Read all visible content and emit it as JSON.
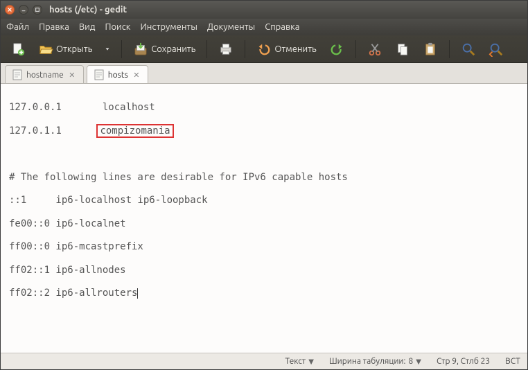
{
  "window": {
    "title": "hosts (/etc) - gedit"
  },
  "menubar": {
    "file": "Файл",
    "edit": "Правка",
    "view": "Вид",
    "search": "Поиск",
    "tools": "Инструменты",
    "documents": "Документы",
    "help": "Справка"
  },
  "toolbar": {
    "open": "Открыть",
    "save": "Сохранить",
    "undo": "Отменить"
  },
  "tabs": [
    {
      "label": "hostname",
      "active": false
    },
    {
      "label": "hosts",
      "active": true
    }
  ],
  "editor": {
    "line1_ip": "127.0.0.1",
    "line1_host": "localhost",
    "line2_ip": "127.0.1.1",
    "line2_host": "compizomania",
    "comment": "# The following lines are desirable for IPv6 capable hosts",
    "l4": "::1     ip6-localhost ip6-loopback",
    "l5": "fe00::0 ip6-localnet",
    "l6": "ff00::0 ip6-mcastprefix",
    "l7": "ff02::1 ip6-allnodes",
    "l8": "ff02::2 ip6-allrouters"
  },
  "statusbar": {
    "lang": "Текст",
    "tab_width_label": "Ширина табуляции:",
    "tab_width_value": "8",
    "cursor": "Стр 9, Стлб 23",
    "ins": "ВСТ"
  }
}
